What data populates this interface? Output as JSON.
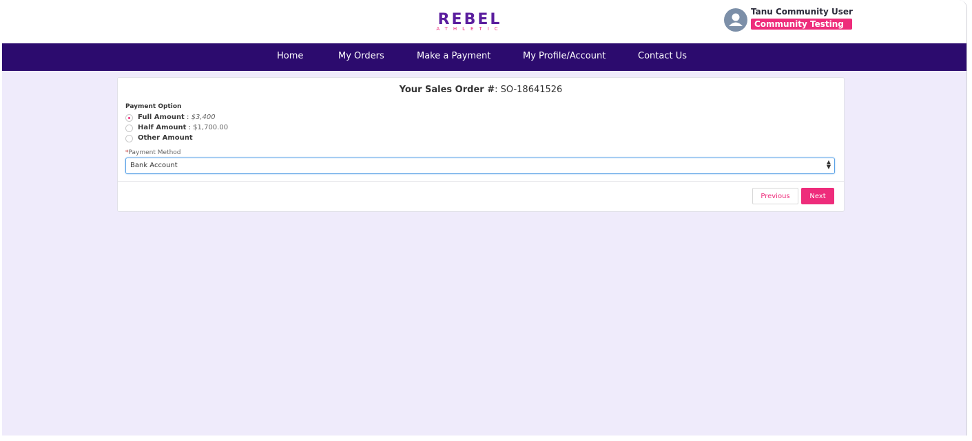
{
  "brand": {
    "logo_word": "REBEL",
    "logo_sub": "ATHLETIC",
    "accent": "#ee2c7b",
    "logo_purple": "#5b1e9e",
    "nav_bg": "#2c0b6e"
  },
  "user": {
    "name": "Tanu Community User",
    "badge": "Community Testing",
    "avatar_icon": "user-avatar-icon"
  },
  "nav": {
    "items": [
      {
        "label": "Home"
      },
      {
        "label": "My Orders"
      },
      {
        "label": "Make a Payment"
      },
      {
        "label": "My Profile/Account"
      },
      {
        "label": "Contact Us"
      }
    ]
  },
  "order": {
    "label": "Your Sales Order #",
    "separator": ": ",
    "number": "SO-18641526"
  },
  "payment_option": {
    "label": "Payment Option",
    "selected": "Full Amount",
    "options": [
      {
        "label": "Full Amount",
        "sep": " : ",
        "amount": "$3,400"
      },
      {
        "label": "Half Amount",
        "sep": " : ",
        "amount": "$1,700.00"
      },
      {
        "label": "Other Amount",
        "sep": "",
        "amount": ""
      }
    ]
  },
  "payment_method": {
    "required_mark": "*",
    "label": "Payment Method",
    "value": "Bank Account"
  },
  "buttons": {
    "previous": "Previous",
    "next": "Next"
  }
}
